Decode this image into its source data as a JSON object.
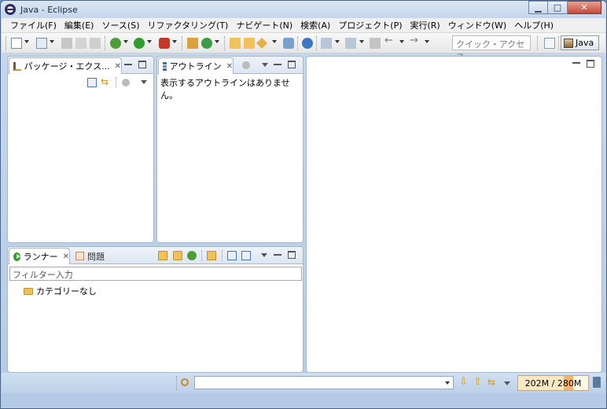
{
  "window": {
    "title": "Java - Eclipse",
    "controls": {
      "minimize": "▁",
      "maximize": "□",
      "close": "✕"
    }
  },
  "menubar": {
    "items": [
      "ファイル(F)",
      "編集(E)",
      "ソース(S)",
      "リファクタリング(T)",
      "ナビゲート(N)",
      "検索(A)",
      "プロジェクト(P)",
      "実行(R)",
      "ウィンドウ(W)",
      "ヘルプ(H)"
    ]
  },
  "toolbar": {
    "quick_access_placeholder": "クイック・アクセス",
    "perspective_label": "Java"
  },
  "package_explorer": {
    "tab_label": "パッケージ・エクス...",
    "close_glyph": "✕"
  },
  "outline": {
    "tab_label": "アウトライン",
    "close_glyph": "✕",
    "message": "表示するアウトラインはありません。"
  },
  "runner": {
    "tab_label": "ランナー",
    "close_glyph": "✕",
    "problems_tab_label": "問題",
    "filter_placeholder": "フィルター入力",
    "tree_items": [
      "カテゴリーなし"
    ]
  },
  "statusbar": {
    "heap_text": "202M / 280M",
    "heap_used_fraction": 0.72
  },
  "colors": {
    "accent": "#4a6487",
    "heap_fill": "#f7b36e"
  }
}
